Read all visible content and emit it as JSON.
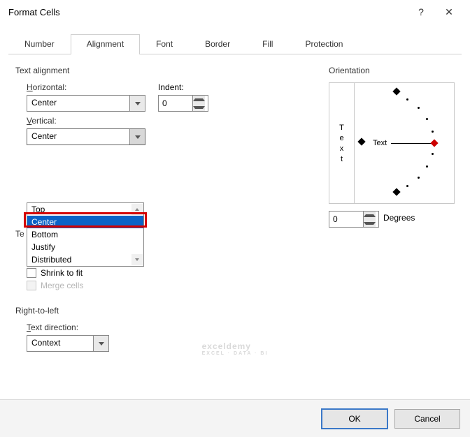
{
  "title": "Format Cells",
  "tabs": [
    "Number",
    "Alignment",
    "Font",
    "Border",
    "Fill",
    "Protection"
  ],
  "active_tab": 1,
  "text_alignment": {
    "group_label": "Text alignment",
    "horizontal_label": "Horizontal:",
    "horizontal_value": "Center",
    "vertical_label": "Vertical:",
    "vertical_value": "Center",
    "vertical_options": [
      "Top",
      "Center",
      "Bottom",
      "Justify",
      "Distributed"
    ],
    "vertical_selected_index": 1,
    "indent_label": "Indent:",
    "indent_value": "0"
  },
  "text_control": {
    "group_label": "Te",
    "shrink_label": "Shrink to fit",
    "merge_label": "Merge cells"
  },
  "rtl": {
    "group_label": "Right-to-left",
    "text_direction_label": "Text direction:",
    "text_direction_value": "Context"
  },
  "orientation": {
    "group_label": "Orientation",
    "vertical_text": [
      "T",
      "e",
      "x",
      "t"
    ],
    "dial_text": "Text",
    "degrees_value": "0",
    "degrees_label": "Degrees"
  },
  "buttons": {
    "ok": "OK",
    "cancel": "Cancel"
  },
  "watermark": {
    "main": "exceldemy",
    "sub": "EXCEL · DATA · BI"
  }
}
